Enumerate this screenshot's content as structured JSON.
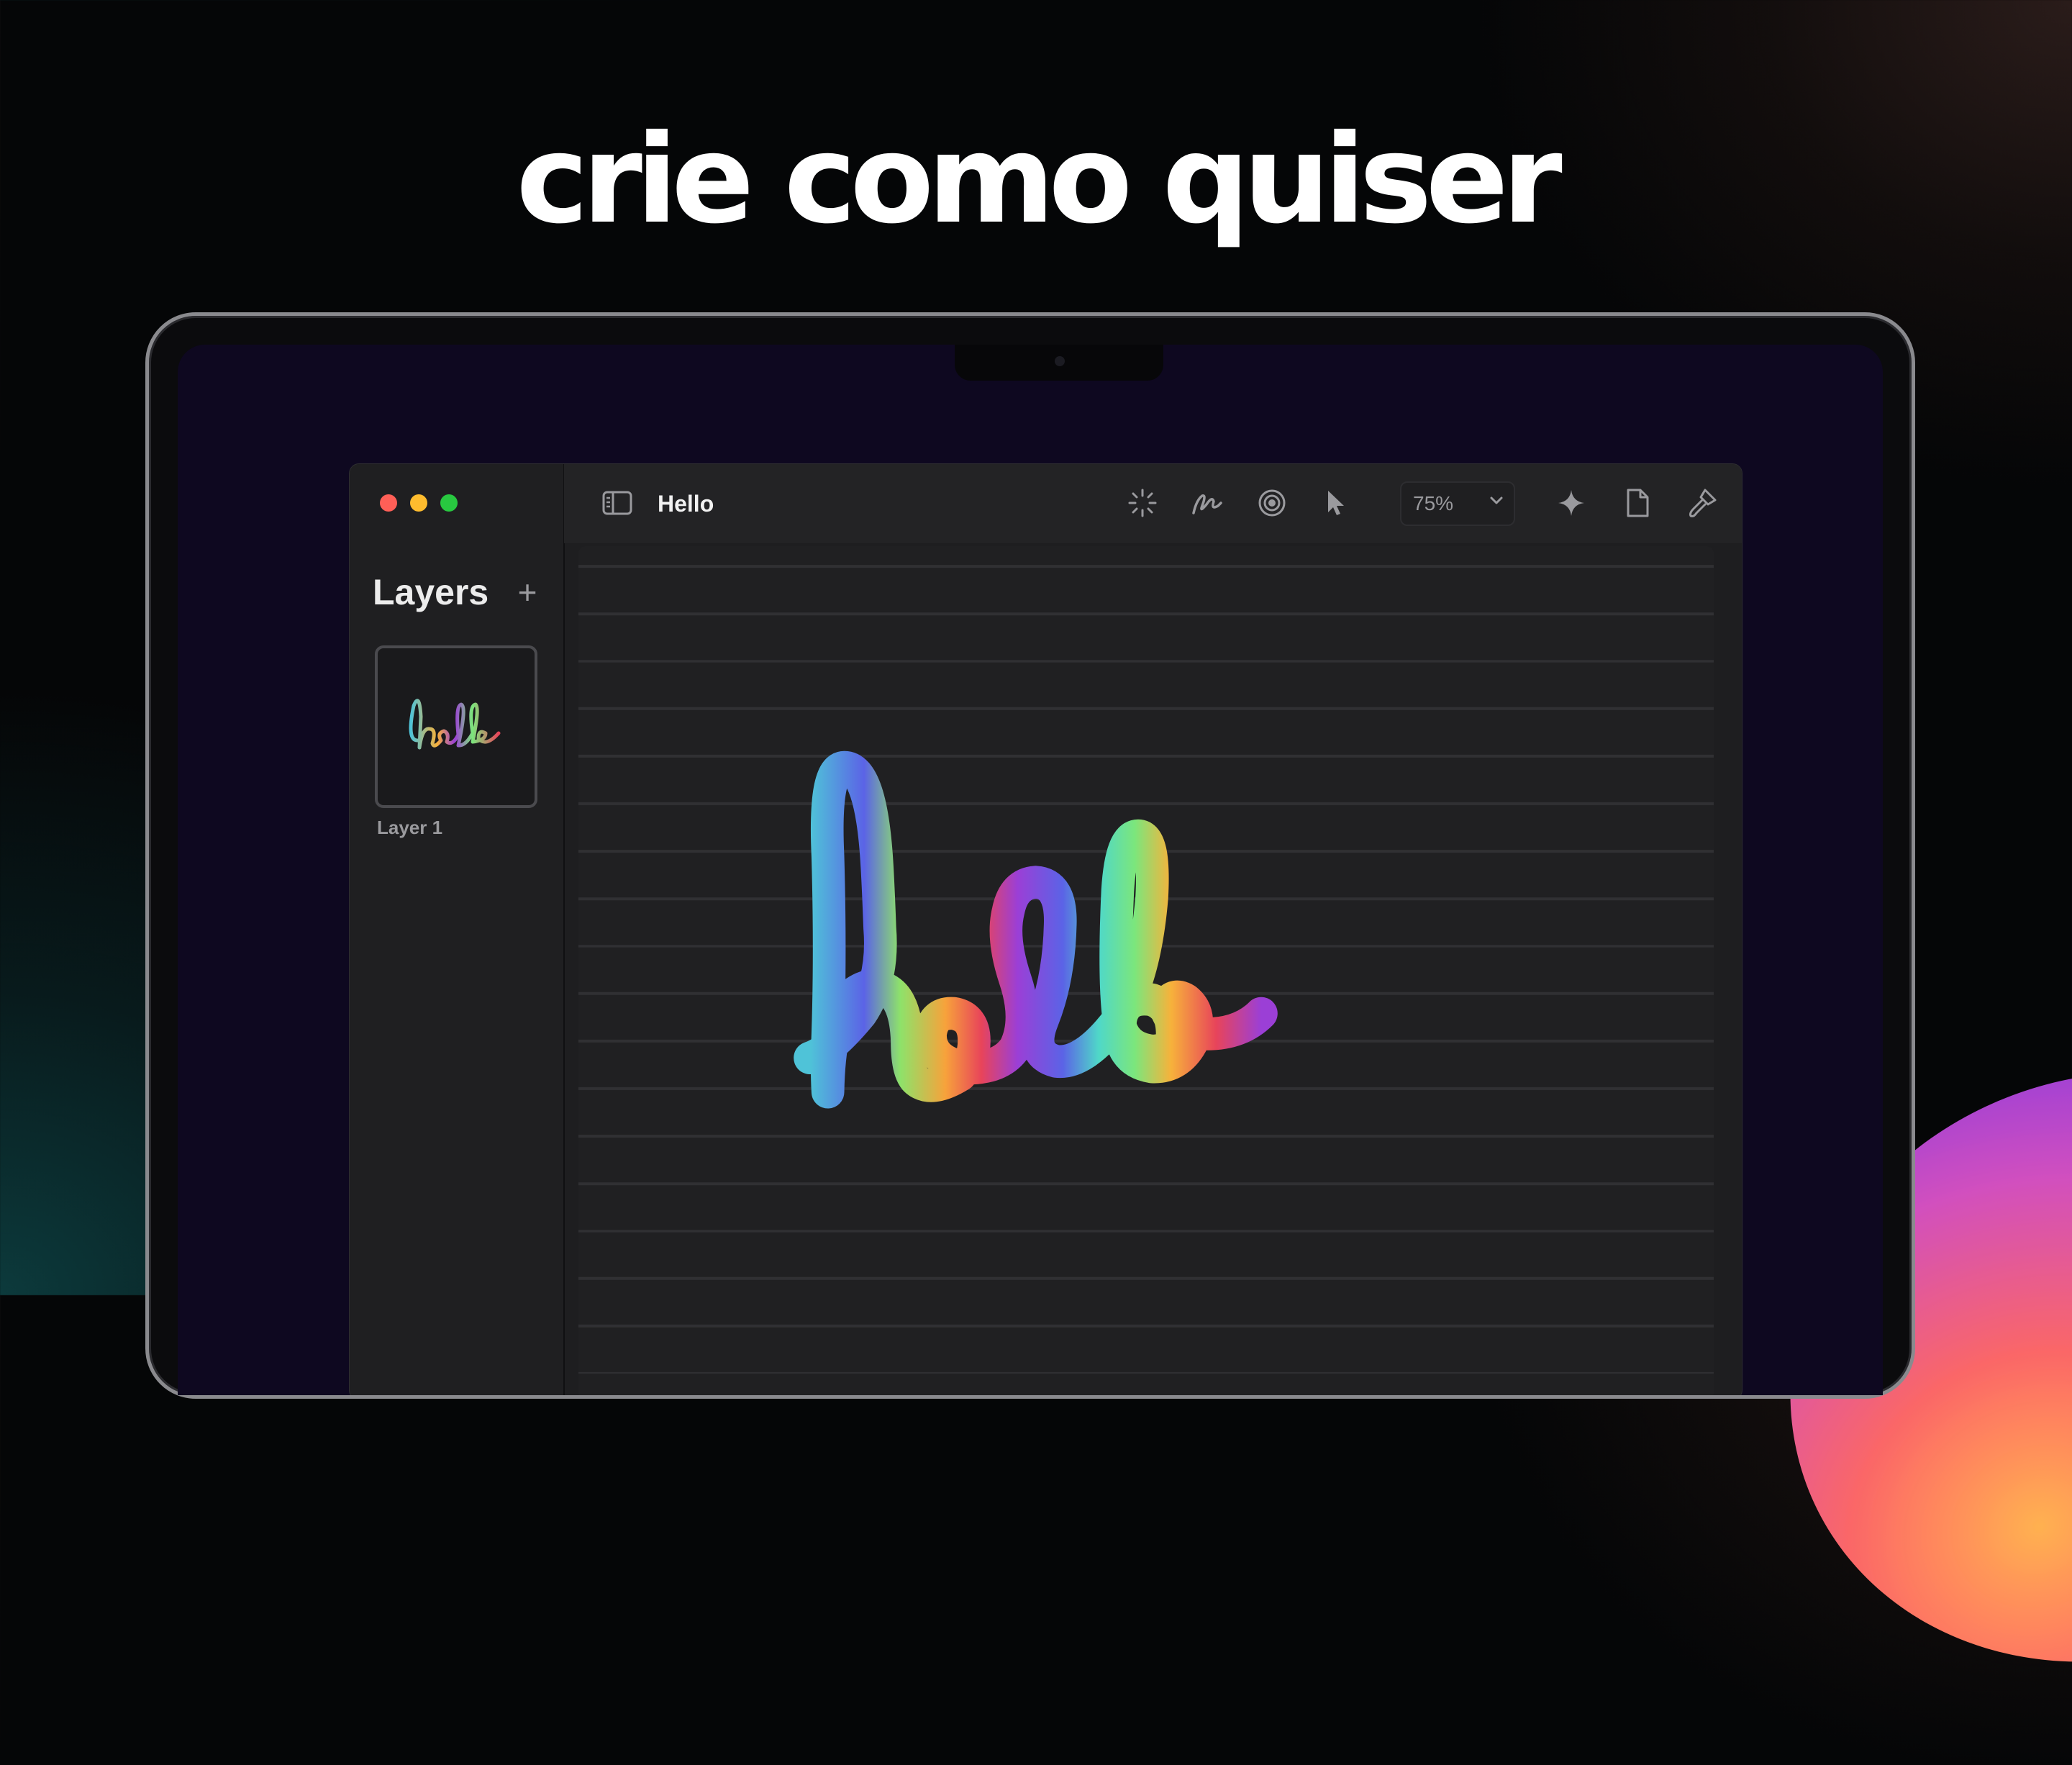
{
  "headline": "crie como quiser",
  "window": {
    "traffic_lights": {
      "close": "#ff5f57",
      "minimize": "#febc2e",
      "zoom": "#28c840"
    }
  },
  "sidebar": {
    "title": "Layers",
    "add_icon": "plus-icon",
    "layers": [
      {
        "label": "Layer 1",
        "thumbnail_text": "hello"
      }
    ]
  },
  "toolbar": {
    "document_title": "Hello",
    "icons": [
      "sidebar-toggle-icon",
      "sparkle-burst-icon",
      "pen-scribble-icon",
      "target-icon",
      "pointer-icon",
      "sparkle-icon",
      "document-icon",
      "brush-icon"
    ],
    "zoom": {
      "value": "75%",
      "chevron": "chevron-down-icon"
    }
  },
  "canvas": {
    "drawing_text": "hello"
  },
  "colors": {
    "stroke_gradient": [
      "#4fc3d8",
      "#5b63e6",
      "#7ce67c",
      "#f7b23b",
      "#e8445a",
      "#9b3fd6"
    ]
  }
}
